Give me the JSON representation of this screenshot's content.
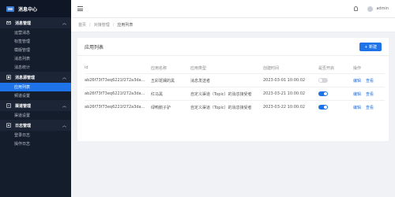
{
  "brand": {
    "title": "消息中心"
  },
  "sidebar": {
    "groups": [
      {
        "label": "消息管理",
        "items": [
          "运营消息",
          "标签管理",
          "模版管理",
          "消息列表",
          "消息统计"
        ]
      },
      {
        "label": "消息源管理",
        "items": [
          "应用列表",
          "频道设置"
        ]
      },
      {
        "label": "渠道管理",
        "items": [
          "渠道设置"
        ]
      },
      {
        "label": "日志管理",
        "items": [
          "登录日志",
          "操作日志"
        ]
      }
    ]
  },
  "topbar": {
    "user": "admin"
  },
  "breadcrumb": [
    "首页",
    "对接管理",
    "应用列表"
  ],
  "card": {
    "title": "应用列表",
    "new_button": "+ 新建"
  },
  "table": {
    "headers": [
      "id",
      "应用名称",
      "应用类型",
      "创建时间",
      "是否开启",
      "操作"
    ],
    "rows": [
      {
        "id": "ab26f73f73eq6221f272a3da...",
        "name": "五彩斑斓的黑",
        "type": "消息发送者",
        "time": "2023-03-01 10:00:02",
        "enabled": false,
        "edit": "编辑",
        "view": "查看"
      },
      {
        "id": "ab26f73f73eq6221f272a3da...",
        "name": "红马黑",
        "type": "自定义渠道（Topic）的消息接受者",
        "time": "2023-03-21 10:00:02",
        "enabled": true,
        "edit": "编辑",
        "view": "查看"
      },
      {
        "id": "ab26f73f73eq6221f272a3da...",
        "name": "绿鸭鹅子驴",
        "type": "自定义渠道（Topic）的消息接受者",
        "time": "2023-03-22 10:00:02",
        "enabled": true,
        "edit": "编辑",
        "view": "查看"
      }
    ]
  },
  "colors": {
    "accent": "#1e73e8",
    "sidebar_bg": "#141d2c"
  }
}
